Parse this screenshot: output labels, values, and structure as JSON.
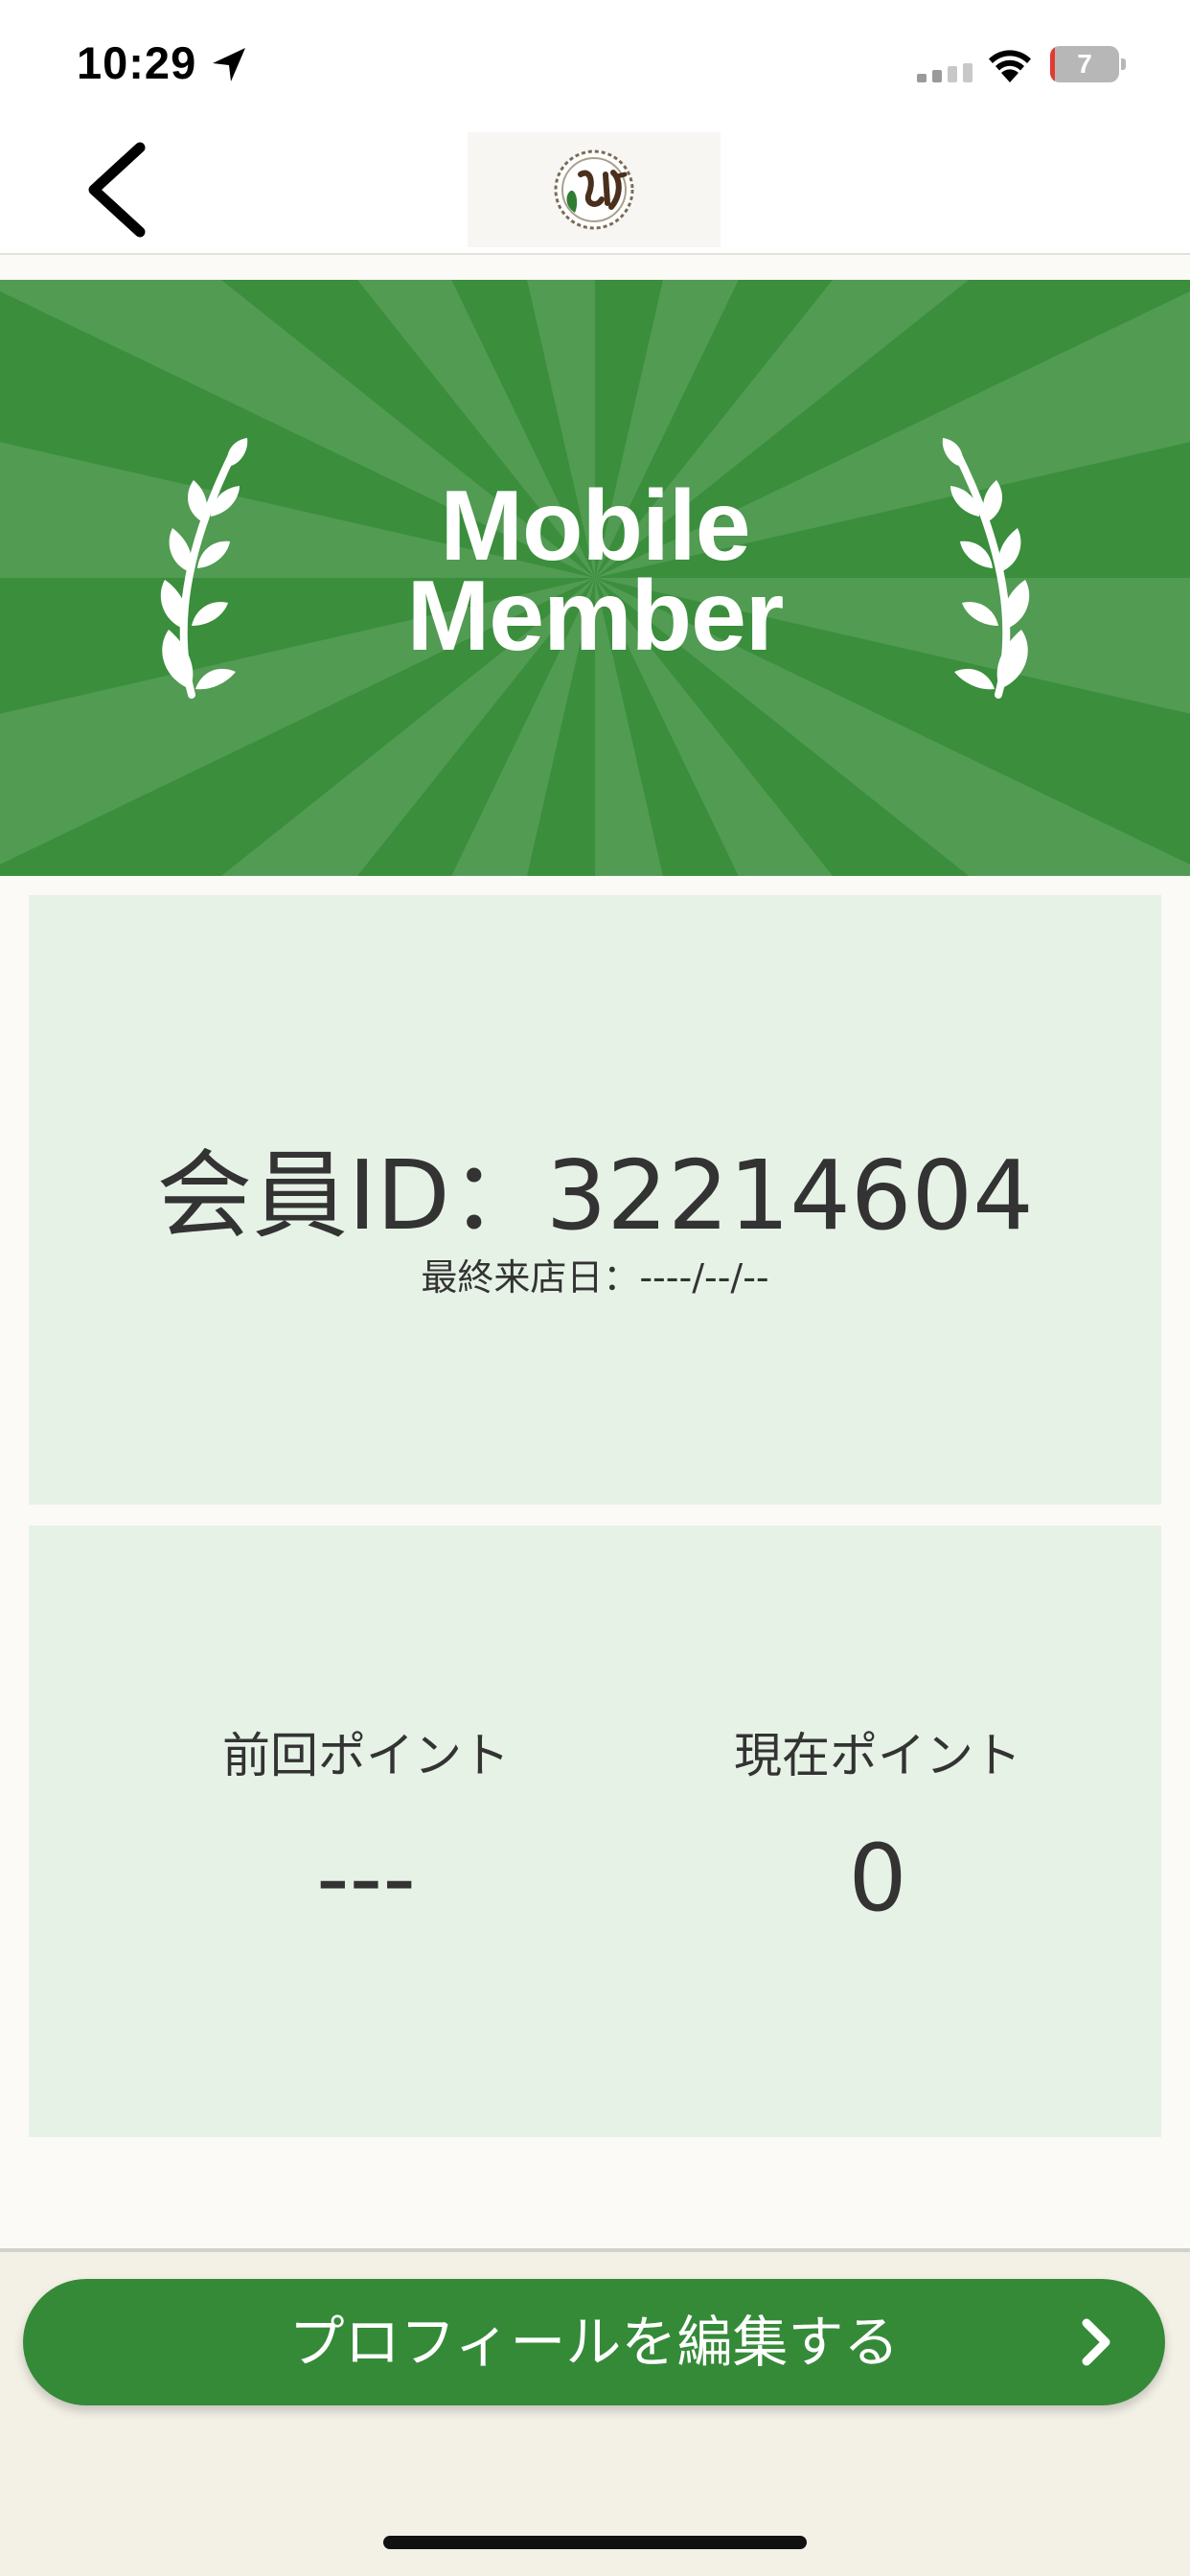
{
  "status_bar": {
    "time": "10:29",
    "battery_level": "7",
    "battery_fraction": 0.07,
    "location_icon": "location-arrow-icon",
    "signal_icon": "cellular-signal-icon",
    "wifi_icon": "wifi-icon"
  },
  "nav": {
    "back_icon": "chevron-left-icon",
    "logo": "store-logo"
  },
  "banner": {
    "title_line1": "Mobile",
    "title_line2": "Member",
    "left_icon": "laurel-branch-icon",
    "right_icon": "laurel-branch-icon"
  },
  "member_card": {
    "member_id_text": "会員ID：32214604",
    "last_visit_text": "最終来店日：----/--/--"
  },
  "points_card": {
    "previous_label": "前回ポイント",
    "previous_value": "---",
    "current_label": "現在ポイント",
    "current_value": "0"
  },
  "footer": {
    "edit_profile_label": "プロフィールを編集する",
    "edit_profile_icon": "chevron-right-icon"
  },
  "colors": {
    "brand_green": "#3a8e3c",
    "button_green": "#358a38",
    "card_background": "#e6f2e6",
    "page_background": "#f3f0e6"
  }
}
